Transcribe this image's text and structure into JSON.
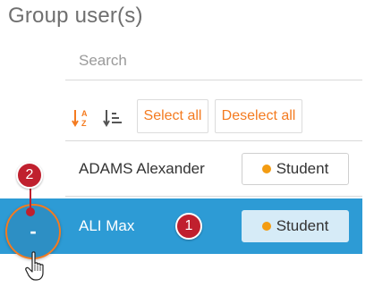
{
  "title": "Group user(s)",
  "search": {
    "placeholder": "Search"
  },
  "toolbar": {
    "sort_alpha_icon": "sort-alpha-icon",
    "sort_list_icon": "sort-list-icon",
    "select_all_label": "Select all",
    "deselect_all_label": "Deselect all"
  },
  "users": [
    {
      "name": "ADAMS Alexander",
      "role": "Student",
      "selected": false
    },
    {
      "name": "ALI Max",
      "role": "Student",
      "selected": true
    }
  ],
  "remove_button": {
    "label": "-"
  },
  "annotations": [
    {
      "number": "1"
    },
    {
      "number": "2"
    }
  ],
  "colors": {
    "accent": "#f47b20",
    "selected_row": "#2d9bd5",
    "badge": "#c0202e",
    "role_dot": "#f39c12"
  }
}
